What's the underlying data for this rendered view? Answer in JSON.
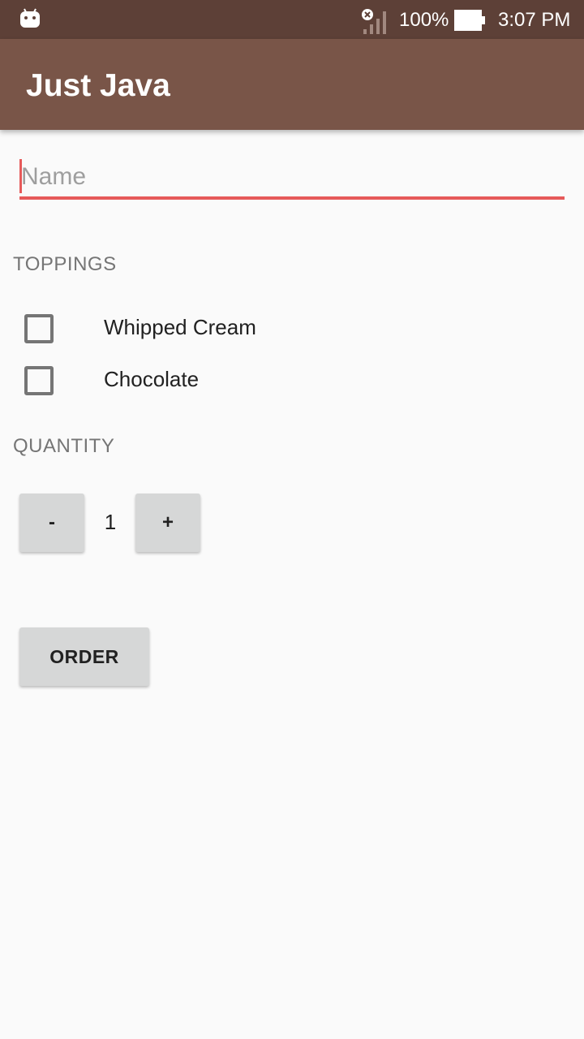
{
  "status_bar": {
    "battery_percent": "100%",
    "time": "3:07 PM",
    "colors": {
      "background": "#5d4037"
    }
  },
  "app_bar": {
    "title": "Just Java",
    "colors": {
      "background": "#795548"
    }
  },
  "name_input": {
    "placeholder": "Name",
    "value": "",
    "accent_color": "#e65a5a"
  },
  "toppings": {
    "heading": "TOPPINGS",
    "items": [
      {
        "label": "Whipped Cream",
        "checked": false
      },
      {
        "label": "Chocolate",
        "checked": false
      }
    ]
  },
  "quantity": {
    "heading": "QUANTITY",
    "decrement_label": "-",
    "value": "1",
    "increment_label": "+"
  },
  "order": {
    "label": "ORDER"
  },
  "icons": [
    "android-icon",
    "signal-icon",
    "battery-icon"
  ]
}
